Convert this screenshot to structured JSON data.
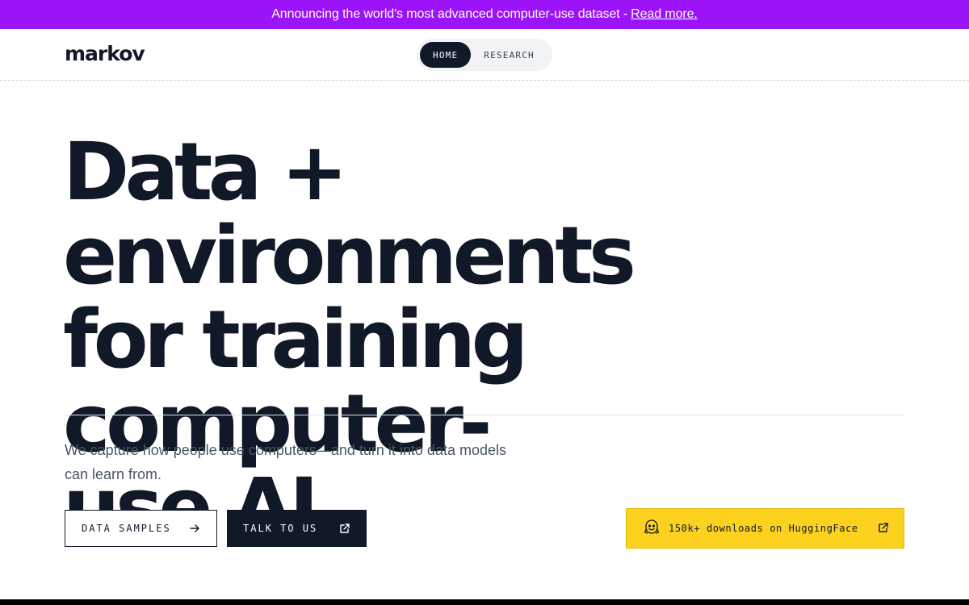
{
  "announcement": {
    "text": "Announcing the world's most advanced computer-use dataset -",
    "link": "Read more."
  },
  "header": {
    "logo": "markov",
    "nav": [
      {
        "label": "HOME",
        "active": true
      },
      {
        "label": "RESEARCH",
        "active": false
      }
    ]
  },
  "hero": {
    "line1": "Data + environments",
    "line2": "for training computer-",
    "line3": "use AI."
  },
  "subtitle": {
    "line1": "We capture how people use computers—and turn it into data models",
    "line2": "can learn from."
  },
  "buttons": {
    "samples": {
      "label": "DATA SAMPLES",
      "icon": "arrow-right-icon"
    },
    "talk": {
      "label": "TALK TO US",
      "icon": "external-link-icon"
    }
  },
  "huggingface": {
    "label": "150k+ downloads on HuggingFace",
    "icon": "huggingface-icon",
    "link_icon": "external-link-icon"
  },
  "colors": {
    "accent": "#9b13f7",
    "dark": "#111827",
    "badge": "#fcd21e"
  }
}
